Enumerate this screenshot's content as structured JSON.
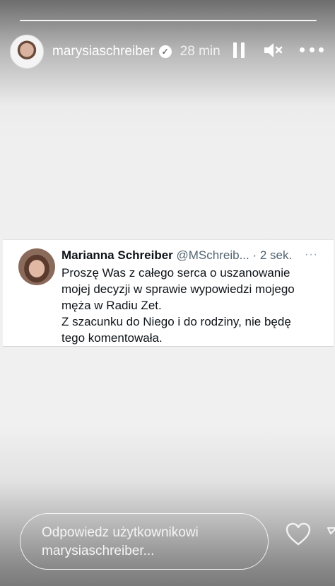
{
  "story": {
    "username": "marysiaschreiber",
    "time_ago": "28 min",
    "progress_segments": 1,
    "icons": {
      "pause": "pause-icon",
      "mute": "speaker-muted-icon",
      "more": "more-horizontal-icon",
      "verified": "verified-badge-icon"
    }
  },
  "tweet": {
    "author_name": "Marianna Schreiber",
    "author_handle": "@MSchreib...",
    "timestamp": "· 2 sek.",
    "more": "···",
    "lines": [
      "Proszę Was z całego serca o uszanowanie",
      "mojej decyzji w sprawie wypowiedzi mojego",
      "męża w Radiu Zet.",
      "Z szacunku do Niego i do rodziny, nie będę",
      "tego komentowała."
    ]
  },
  "reply": {
    "placeholder": "Odpowiedz użytkownikowi marysiaschreiber..."
  },
  "colors": {
    "tweet_text": "#0f1419",
    "tweet_secondary": "#536471",
    "overlay_text": "#ffffff"
  }
}
